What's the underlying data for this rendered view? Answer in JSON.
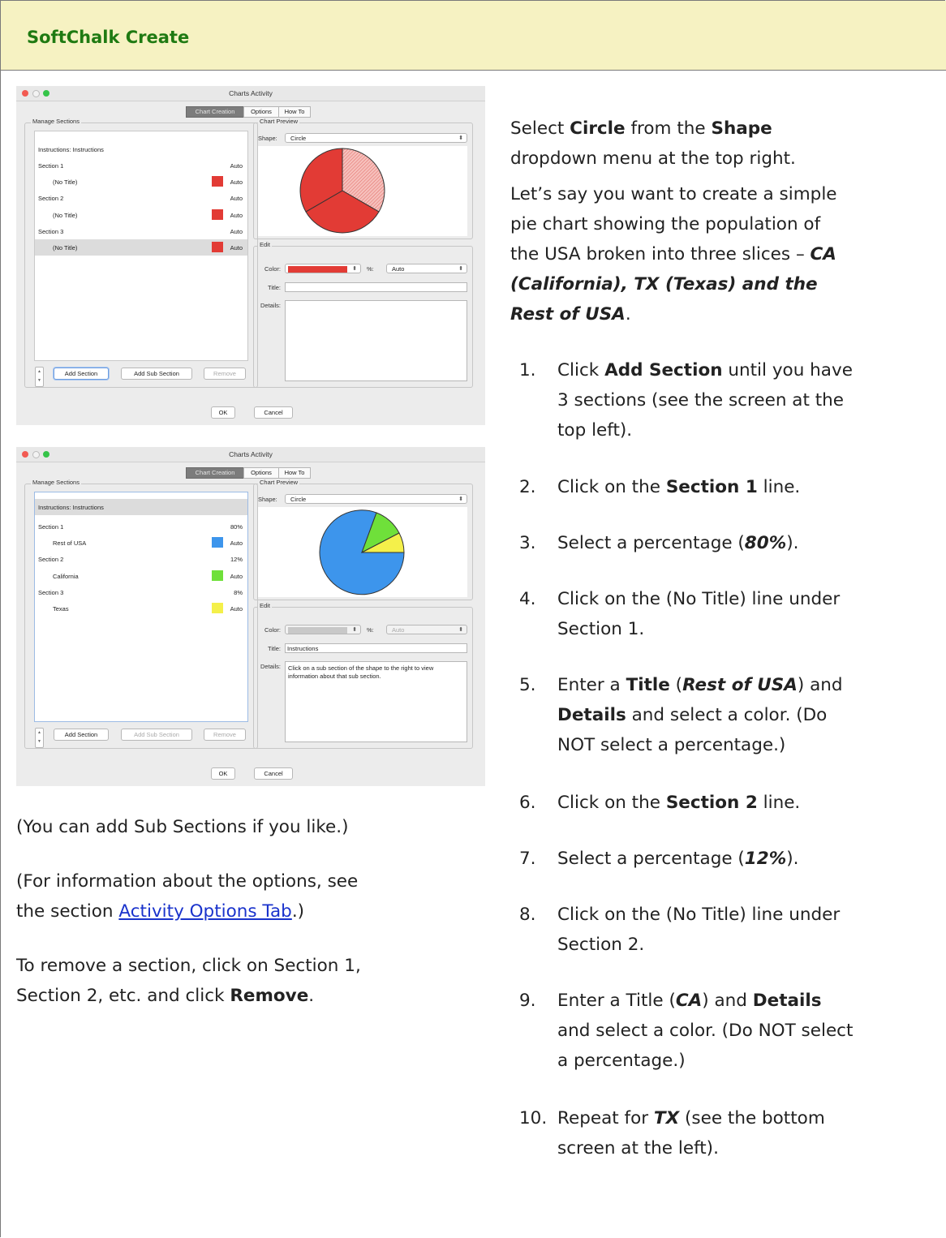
{
  "header": {
    "title": "SoftChalk Create"
  },
  "right": {
    "intro1": {
      "a": "Select ",
      "b1": "Circle",
      "c": " from the ",
      "b2": "Shape",
      "d": "dropdown menu at the top right."
    },
    "intro2": {
      "l1": "Let’s say you want to create a simple",
      "l2": "pie chart showing the population of",
      "l3a": "the USA broken into three slices – ",
      "l3b": "CA",
      "l4": "(California), TX (Texas) and the",
      "l5a": "Rest of USA",
      "l5b": "."
    },
    "steps": [
      {
        "num": "1.",
        "l1a": "Click ",
        "l1b": "Add Section",
        "l1c": " until you have",
        "l2": "3 sections (see the screen at the",
        "l3": "top left)."
      },
      {
        "num": "2.",
        "a": "Click on the ",
        "b": "Section 1",
        "c": " line."
      },
      {
        "num": "3.",
        "a": "Select a percentage (",
        "b": "80%",
        "c": ")."
      },
      {
        "num": "4.",
        "l1": "Click on the (No Title) line under",
        "l2": "Section 1."
      },
      {
        "num": "5.",
        "l1a": "Enter a ",
        "l1b": "Title",
        "l1c": " (",
        "l1d": "Rest of USA",
        "l1e": ") and",
        "l2a": "Details",
        "l2b": " and select a color. (Do",
        "l3": "NOT select a percentage.)"
      },
      {
        "num": "6.",
        "a": "Click on the ",
        "b": "Section 2",
        "c": " line."
      },
      {
        "num": "7.",
        "a": "Select a percentage (",
        "b": "12%",
        "c": ")."
      },
      {
        "num": "8.",
        "l1": "Click on the (No Title) line under",
        "l2": "Section 2."
      },
      {
        "num": "9.",
        "l1a": "Enter a Title (",
        "l1b": "CA",
        "l1c": ") and ",
        "l1d": "Details",
        "l2": "and select a color. (Do NOT select",
        "l3": "a percentage.)"
      },
      {
        "num": "10.",
        "l1a": "Repeat for ",
        "l1b": "TX",
        "l1c": " (see the bottom",
        "l2": "screen at the left)."
      }
    ]
  },
  "left": {
    "p1": "(You can add Sub Sections if you like.)",
    "p2a": "(For information about the options, see",
    "p2b": "the section ",
    "p2link": "Activity Options Tab",
    "p2c": ".)",
    "p3a": "To remove a section, click on Section 1,",
    "p3b": "Section 2, etc. and click ",
    "p3c": "Remove",
    "p3d": "."
  },
  "win1": {
    "title": "Charts Activity",
    "tabs": [
      "Chart Creation",
      "Options",
      "How To"
    ],
    "manage_label": "Manage Sections",
    "preview_label": "Chart Preview",
    "shape_label": "Shape:",
    "shape_value": "Circle",
    "rows": [
      {
        "label": "Instructions: Instructions",
        "value": ""
      },
      {
        "label": "Section 1",
        "value": "Auto"
      },
      {
        "label": "(No Title)",
        "value": "Auto"
      },
      {
        "label": "Section 2",
        "value": "Auto"
      },
      {
        "label": "(No Title)",
        "value": "Auto"
      },
      {
        "label": "Section 3",
        "value": "Auto"
      },
      {
        "label": "(No Title)",
        "value": "Auto"
      }
    ],
    "edit_label": "Edit",
    "color_label": "Color:",
    "pct_label": "%:",
    "pct_value": "Auto",
    "title_label": "Title:",
    "title_value": "",
    "details_label": "Details:",
    "details_value": "",
    "add_section": "Add Section",
    "add_sub": "Add Sub Section",
    "remove": "Remove",
    "ok": "OK",
    "cancel": "Cancel",
    "stepper_up": "▲",
    "stepper_down": "▼",
    "colors": {
      "slice": "#e23b35",
      "light": "#f2a5a0"
    }
  },
  "win2": {
    "title": "Charts Activity",
    "tabs": [
      "Chart Creation",
      "Options",
      "How To"
    ],
    "manage_label": "Manage Sections",
    "preview_label": "Chart Preview",
    "shape_label": "Shape:",
    "shape_value": "Circle",
    "rows": [
      {
        "label": "Instructions: Instructions",
        "value": ""
      },
      {
        "label": "Section 1",
        "value": "80%"
      },
      {
        "label": "Rest of USA",
        "value": "Auto"
      },
      {
        "label": "Section 2",
        "value": "12%"
      },
      {
        "label": "California",
        "value": "Auto"
      },
      {
        "label": "Section 3",
        "value": "8%"
      },
      {
        "label": "Texas",
        "value": "Auto"
      }
    ],
    "edit_label": "Edit",
    "color_label": "Color:",
    "pct_label": "%:",
    "pct_value": "Auto",
    "title_label": "Title:",
    "title_value": "Instructions",
    "details_label": "Details:",
    "details_value": "Click on a sub section of the shape to the right to view information about that sub section.",
    "add_section": "Add Section",
    "add_sub": "Add Sub Section",
    "remove": "Remove",
    "ok": "OK",
    "cancel": "Cancel",
    "stepper_up": "▲",
    "stepper_down": "▼",
    "colors": {
      "blue": "#3d95ec",
      "green": "#6fe03a",
      "yellow": "#f4f04a"
    }
  }
}
